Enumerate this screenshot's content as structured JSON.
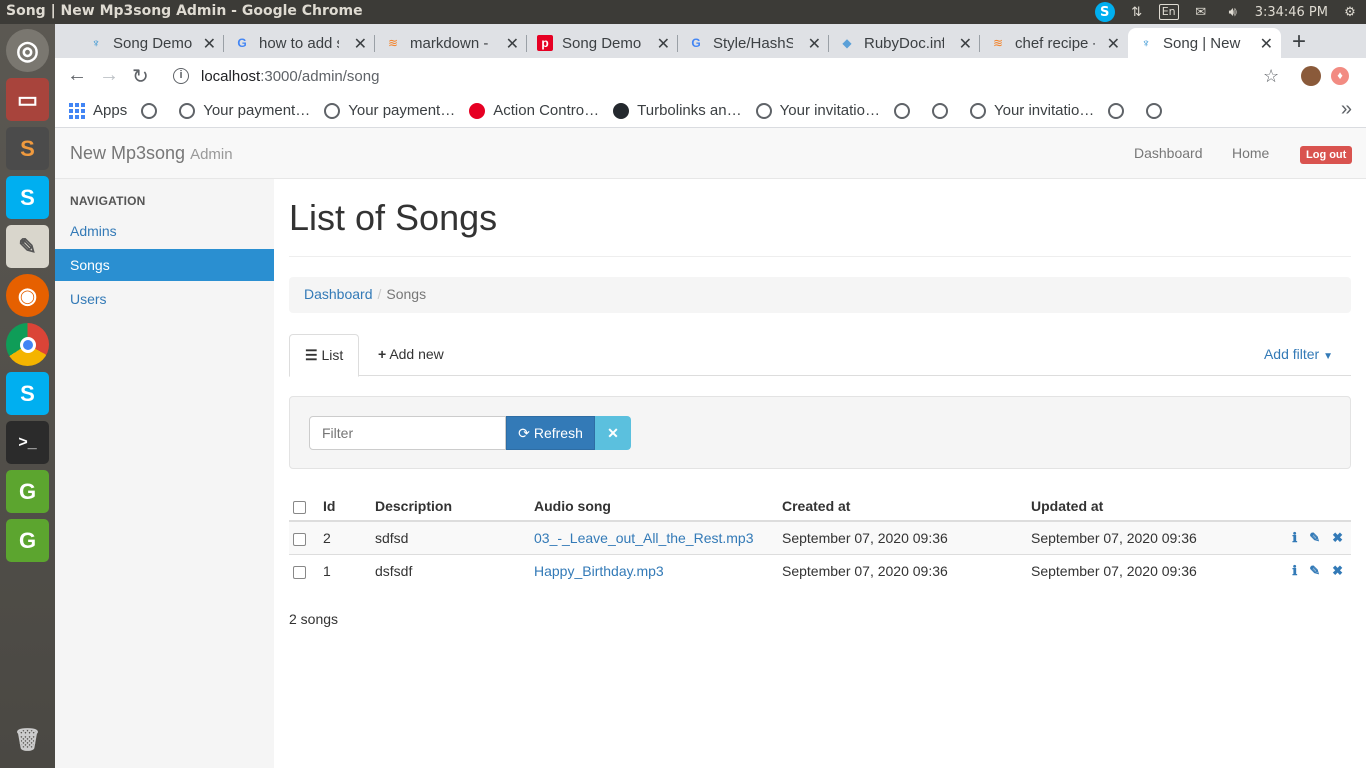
{
  "os": {
    "window_title": "Song | New Mp3song Admin - Google Chrome",
    "time": "3:34:46 PM",
    "keyboard_layout": "En",
    "launcher_icons": [
      "ubuntu-dash-icon",
      "files-icon",
      "sublime-text-icon",
      "skype-icon",
      "text-editor-icon",
      "firefox-icon",
      "chrome-icon",
      "skype-icon",
      "terminal-icon",
      "gitg-icon",
      "gitg-icon",
      "trash-icon"
    ]
  },
  "browser": {
    "tabs": [
      {
        "title": "Song Demo",
        "icon": "ruby-icon"
      },
      {
        "title": "how to add s",
        "icon": "google-icon"
      },
      {
        "title": "markdown - I",
        "icon": "stackoverflow-icon"
      },
      {
        "title": "Song Demo",
        "icon": "pinterest-icon"
      },
      {
        "title": "Style/HashSy",
        "icon": "google-icon"
      },
      {
        "title": "RubyDoc.info",
        "icon": "rubydoc-icon"
      },
      {
        "title": "chef recipe -",
        "icon": "stackoverflow-icon"
      },
      {
        "title": "Song | New M",
        "icon": "ruby-icon",
        "active": true
      }
    ],
    "url_host": "localhost",
    "url_path": ":3000/admin/song",
    "bookmarks": [
      {
        "label": "Apps",
        "icon": "apps-icon"
      },
      {
        "label": "",
        "icon": "globe-icon"
      },
      {
        "label": "Your payment…",
        "icon": "globe-icon"
      },
      {
        "label": "Your payment…",
        "icon": "globe-icon"
      },
      {
        "label": "Action Contro…",
        "icon": "pinterest-icon"
      },
      {
        "label": "Turbolinks an…",
        "icon": "github-icon"
      },
      {
        "label": "Your invitatio…",
        "icon": "globe-icon"
      },
      {
        "label": "",
        "icon": "globe-icon"
      },
      {
        "label": "",
        "icon": "globe-icon"
      },
      {
        "label": "Your invitatio…",
        "icon": "globe-icon"
      },
      {
        "label": "",
        "icon": "globe-icon"
      },
      {
        "label": "",
        "icon": "globe-icon"
      }
    ]
  },
  "app": {
    "brand": "New Mp3song",
    "brand_suffix": "Admin",
    "nav": {
      "dashboard": "Dashboard",
      "home": "Home",
      "logout": "Log out"
    },
    "sidebar": {
      "header": "NAVIGATION",
      "items": [
        {
          "label": "Admins"
        },
        {
          "label": "Songs",
          "active": true
        },
        {
          "label": "Users"
        }
      ]
    },
    "page_title": "List of Songs",
    "breadcrumb": {
      "parent": "Dashboard",
      "current": "Songs"
    },
    "tabs": {
      "list": "List",
      "add_new": "Add new",
      "add_filter": "Add filter"
    },
    "filter": {
      "placeholder": "Filter",
      "refresh": "Refresh"
    },
    "table": {
      "columns": [
        "Id",
        "Description",
        "Audio song",
        "Created at",
        "Updated at"
      ],
      "rows": [
        {
          "id": "2",
          "description": "sdfsd",
          "audio": "03_-_Leave_out_All_the_Rest.mp3",
          "created": "September 07, 2020 09:36",
          "updated": "September 07, 2020 09:36"
        },
        {
          "id": "1",
          "description": "dsfsdf",
          "audio": "Happy_Birthday.mp3",
          "created": "September 07, 2020 09:36",
          "updated": "September 07, 2020 09:36"
        }
      ]
    },
    "count": "2 songs"
  },
  "colors": {
    "primary": "#337ab7",
    "sidebar_active": "#2a8fd1",
    "danger": "#d9534f",
    "info": "#5bc0de"
  }
}
